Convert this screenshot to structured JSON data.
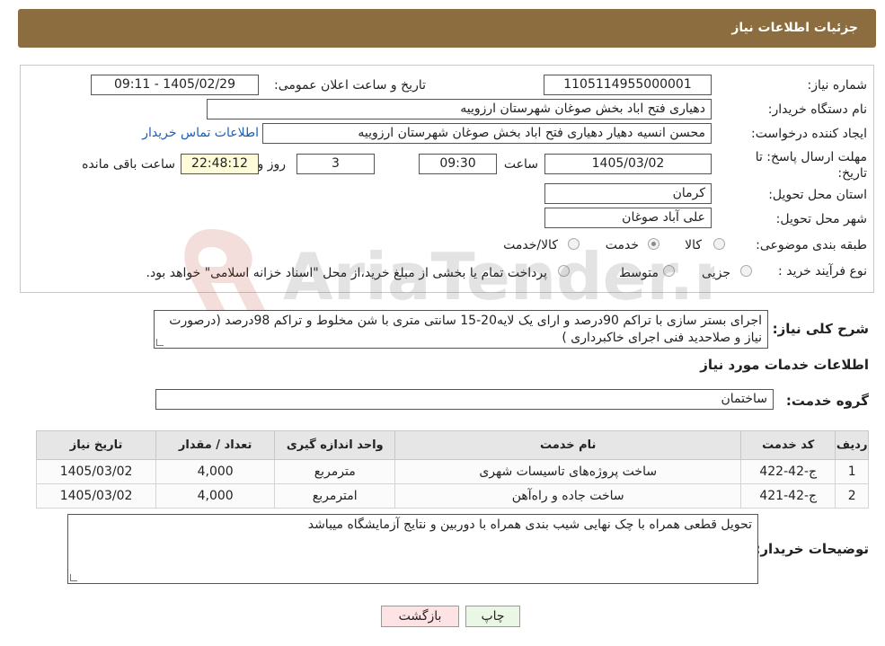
{
  "header": {
    "title": "جزئیات اطلاعات نیاز"
  },
  "form": {
    "need_number_label": "شماره نیاز:",
    "need_number": "1105114955000001",
    "announce_label": "تاریخ و ساعت اعلان عمومی:",
    "announce_value": "1405/02/29 - 09:11",
    "buyer_org_label": "نام دستگاه خریدار:",
    "buyer_org": "دهیاری فتح اباد بخش صوغان شهرستان ارزوییه",
    "creator_label": "ایجاد کننده درخواست:",
    "creator": "محسن انسیه دهیار دهیاری فتح اباد بخش صوغان شهرستان ارزوییه",
    "contact_link": "اطلاعات تماس خریدار",
    "deadline_label": "مهلت ارسال پاسخ: تا تاریخ:",
    "deadline_date": "1405/03/02",
    "time_label": "ساعت",
    "deadline_time": "09:30",
    "days_value": "3",
    "days_label": "روز و",
    "remaining_time": "22:48:12",
    "remaining_label": "ساعت باقی مانده",
    "province_label": "استان محل تحویل:",
    "province": "کرمان",
    "city_label": "شهر محل تحویل:",
    "city": "علی آباد صوغان",
    "category_label": "طبقه بندی موضوعی:",
    "category_options": [
      "کالا",
      "خدمت",
      "کالا/خدمت"
    ],
    "category_selected": "کالا",
    "process_label": "نوع فرآیند خرید :",
    "process_options": [
      "جزیی",
      "متوسط"
    ],
    "payment_text": "پرداخت تمام یا بخشی از مبلغ خرید،از محل \"اسناد خزانه اسلامی\" خواهد بود."
  },
  "description": {
    "label": "شرح کلی نیاز:",
    "text": "اجرای بستر سازی با تراکم 90درصد و ارای یک لایه20-15 سانتی متری با شن مخلوط و تراکم 98درصد (درصورت نیاز و صلاحدید فنی اجرای خاکبرداری )"
  },
  "services": {
    "section_title": "اطلاعات خدمات مورد نیاز",
    "group_label": "گروه خدمت:",
    "group_value": "ساختمان",
    "columns": [
      "ردیف",
      "کد خدمت",
      "نام خدمت",
      "واحد اندازه گیری",
      "تعداد / مقدار",
      "تاریخ نیاز"
    ],
    "rows": [
      {
        "row": "1",
        "code": "ج-42-422",
        "name": "ساخت پروژه‌های تاسیسات شهری",
        "unit": "مترمربع",
        "qty": "4,000",
        "date": "1405/03/02"
      },
      {
        "row": "2",
        "code": "ج-42-421",
        "name": "ساخت جاده و راه‌آهن",
        "unit": "امترمربع",
        "qty": "4,000",
        "date": "1405/03/02"
      }
    ]
  },
  "notes": {
    "label": "توضیحات خریدار:",
    "text": "تحویل قطعی همراه با چک نهایی شیب بندی همراه با دوربین و نتایج آزمایشگاه میباشد"
  },
  "buttons": {
    "print": "چاپ",
    "back": "بازگشت"
  },
  "watermark": {
    "text": "AriaTender.neT"
  },
  "colors": {
    "header_bg": "#8c6d3f",
    "link": "#1a5fb4",
    "back_button_bg": "#fde3e3",
    "print_button_bg": "#eaf7e4",
    "remaining_bg": "#fdfbd9"
  }
}
